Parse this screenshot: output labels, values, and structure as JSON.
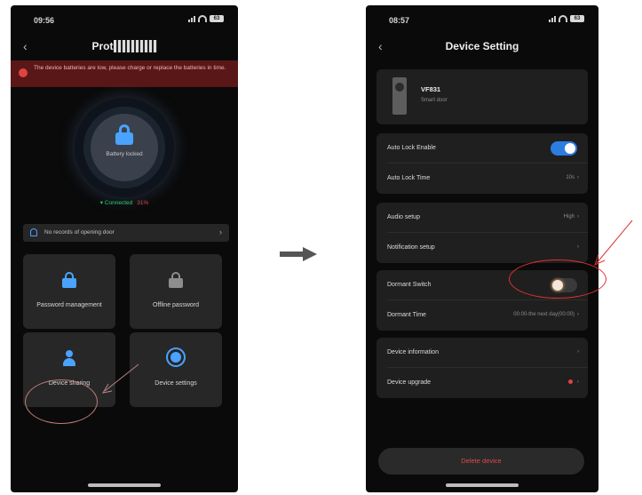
{
  "left_screen": {
    "status_time": "09:56",
    "battery": "63",
    "title": "Prot",
    "warning_text": "The device batteries are low, please charge or replace the batteries in time.",
    "lock_status": "Battery locked",
    "connection": "Connected",
    "battery_level": "31%",
    "notice": "No records of opening door",
    "tiles": [
      {
        "label": "Password management"
      },
      {
        "label": "Offline password"
      },
      {
        "label": "Device sharing"
      },
      {
        "label": "Device settings"
      }
    ]
  },
  "right_screen": {
    "status_time": "08:57",
    "battery": "63",
    "title": "Device Setting",
    "device": {
      "name": "VF831",
      "subtitle": "Smart door"
    },
    "rows": {
      "auto_lock_enable": "Auto Lock Enable",
      "auto_lock_time": "Auto Lock Time",
      "auto_lock_time_value": "10s",
      "audio_setup": "Audio setup",
      "audio_setup_value": "High",
      "notification_setup": "Notification setup",
      "dormant_switch": "Dormant Switch",
      "dormant_time": "Dormant Time",
      "dormant_time_value": "00:00-the next day(00:00)",
      "device_information": "Device information",
      "device_upgrade": "Device upgrade"
    },
    "delete_button": "Delete device"
  },
  "toggles": {
    "auto_lock_enable": true,
    "dormant_switch": false
  },
  "colors": {
    "accent": "#2c7de0",
    "danger": "#e04343",
    "annotation": "#e03030"
  }
}
